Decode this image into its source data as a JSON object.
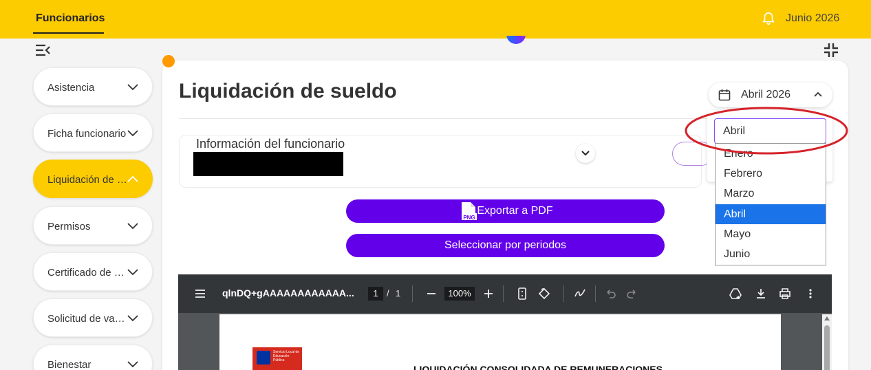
{
  "topbar": {
    "tab_label": "Funcionarios",
    "period_label": "Junio 2026"
  },
  "sidebar": {
    "items": [
      {
        "label": "Asistencia"
      },
      {
        "label": "Ficha funcionario"
      },
      {
        "label": "Liquidación de sueldo"
      },
      {
        "label": "Permisos"
      },
      {
        "label": "Certificado de antigüedad"
      },
      {
        "label": "Solicitud de vacaciones"
      },
      {
        "label": "Bienestar"
      }
    ]
  },
  "main": {
    "title": "Liquidación de sueldo",
    "period_selector": {
      "value": "Abril 2026"
    },
    "info_panel": {
      "title": "Información del funcionario"
    },
    "export_button": {
      "label": "Exportar a PDF",
      "badge": "PNG"
    },
    "periods_button": {
      "label": "Seleccionar por periodos"
    }
  },
  "month_dropdown": {
    "search_value": "Abril",
    "options": [
      "Enero",
      "Febrero",
      "Marzo",
      "Abril",
      "Mayo",
      "Junio"
    ],
    "selected": "Abril"
  },
  "pdf_viewer": {
    "file_name": "qlnDQ+gAAAAAAAAAAAA...",
    "page_current": "1",
    "page_separator": "/",
    "page_total": "1",
    "zoom": "100%",
    "document_heading": "LIQUIDACIÓN CONSOLIDADA DE REMUNERACIONES",
    "logo_text": "Servicio Local de Educación Pública"
  },
  "colors": {
    "topbar": "#fccb00",
    "primary_button": "#6200ea",
    "selected_option": "#1a73e8",
    "annotation": "#d6232a"
  }
}
